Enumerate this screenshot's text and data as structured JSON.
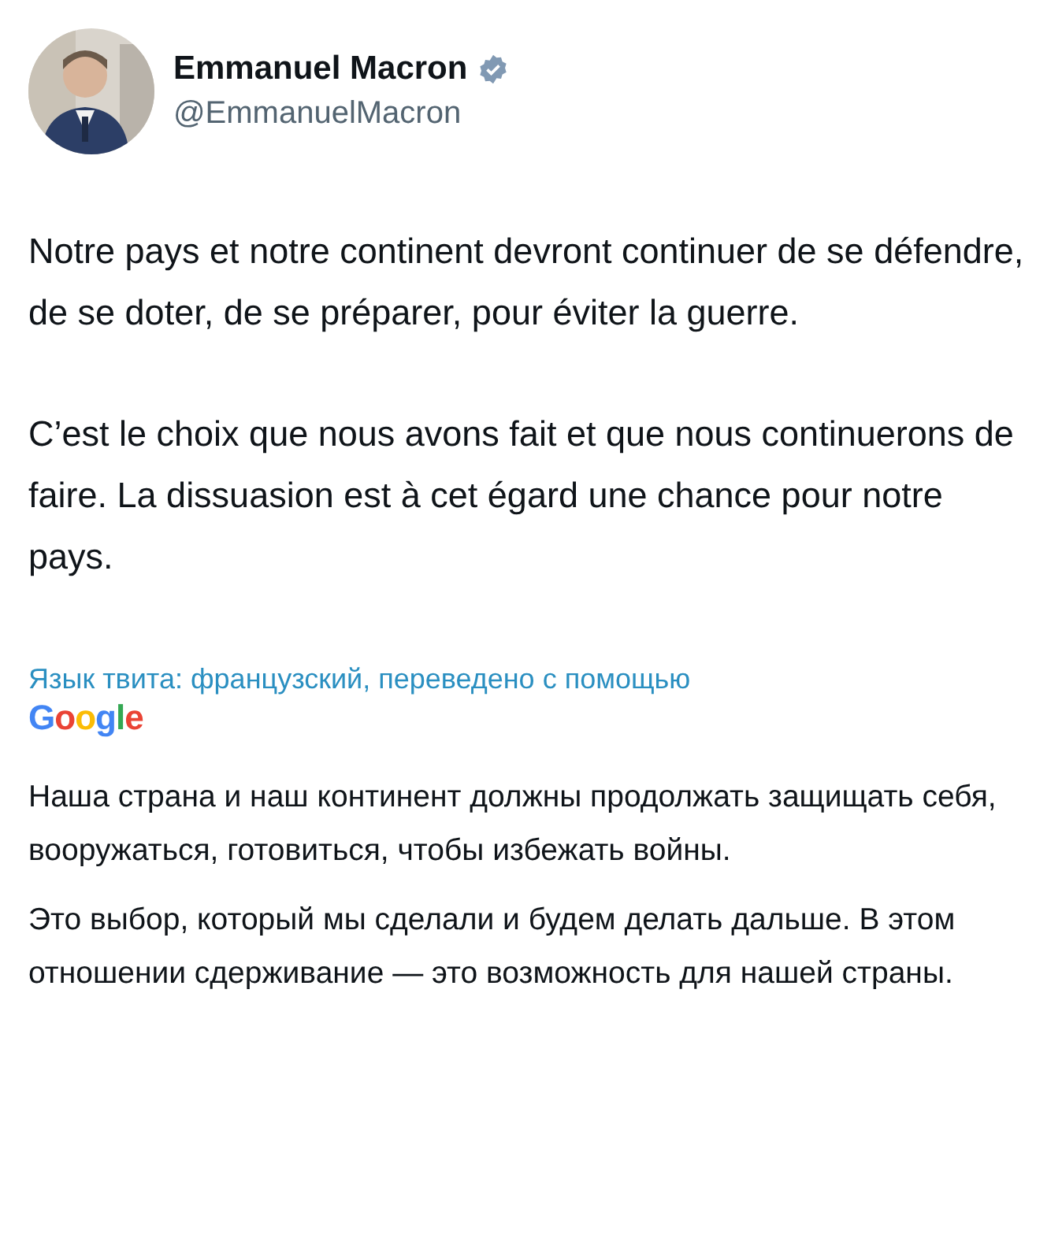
{
  "author": {
    "name": "Emmanuel Macron",
    "handle": "@EmmanuelMacron",
    "verified": true
  },
  "tweet_paragraphs": [
    "Notre pays et notre continent devront continuer de se défendre, de se doter, de se préparer, pour éviter la guerre.",
    "C’est le choix que nous avons fait et que nous continuerons de faire. La dissuasion est à cet égard une chance pour notre pays."
  ],
  "translation": {
    "caption": "Язык твита: французский, переведено с помощью",
    "provider": "Google",
    "paragraphs": [
      "Наша страна и наш континент должны продолжать защищать себя, вооружаться, готовиться, чтобы избежать войны.",
      "Это выбор, который мы сделали и будем делать дальше. В этом отношении сдерживание — это возможность для нашей страны."
    ]
  }
}
